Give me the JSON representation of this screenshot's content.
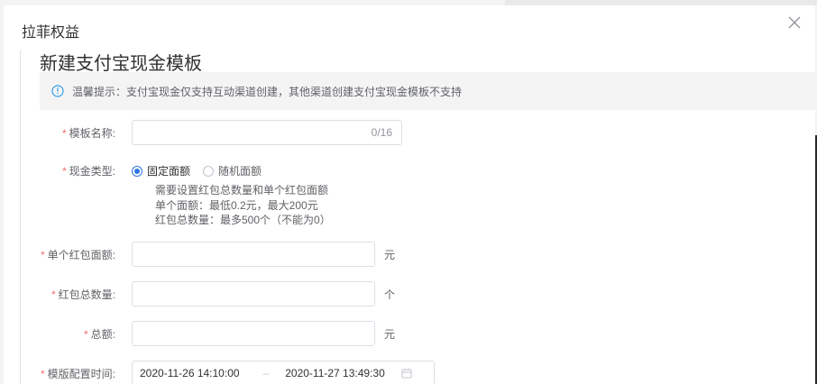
{
  "dialog": {
    "title": "拉菲权益"
  },
  "form": {
    "title": "新建支付宝现金模板",
    "tip": "温馨提示：支付宝现金仅支持互动渠道创建，其他渠道创建支付宝现金模板不支持",
    "required_mark": "*",
    "template_name": {
      "label": "模板名称:",
      "value": "",
      "counter": "0/16"
    },
    "cash_type": {
      "label": "现金类型:",
      "options": [
        {
          "label": "固定面额",
          "selected": true
        },
        {
          "label": "随机面额",
          "selected": false
        }
      ],
      "notes": [
        "需要设置红包总数量和单个红包面额",
        "单个面额：最低0.2元，最大200元",
        "红包总数量：最多500个（不能为0）"
      ]
    },
    "single_amount": {
      "label": "单个红包面额:",
      "value": "",
      "unit": "元"
    },
    "total_count": {
      "label": "红包总数量:",
      "value": "",
      "unit": "个"
    },
    "total_amount": {
      "label": "总额:",
      "value": "",
      "unit": "元"
    },
    "config_time": {
      "label": "模版配置时间:",
      "start": "2020-11-26 14:10:00",
      "separator": "–",
      "end": "2020-11-27 13:49:30"
    }
  },
  "colors": {
    "accent": "#2f76e5",
    "required": "#f56c6c",
    "tip_background": "#f4f4f5"
  },
  "icons": {
    "close": "close-icon",
    "info": "info-circle-icon",
    "calendar": "calendar-icon"
  }
}
